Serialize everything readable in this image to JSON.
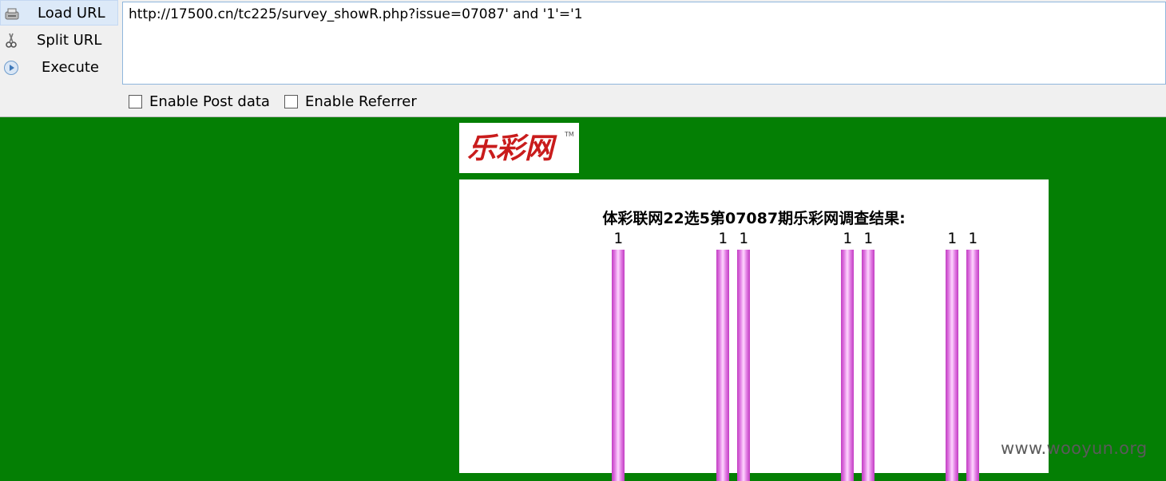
{
  "toolbar": {
    "load_url": "Load URL",
    "split_url": "Split URL",
    "execute": "Execute",
    "url_value": "http://17500.cn/tc225/survey_showR.php?issue=07087' and '1'='1",
    "enable_post": "Enable Post data",
    "enable_referrer": "Enable Referrer"
  },
  "page": {
    "background_color": "#047f04",
    "logo_text": "乐彩网",
    "logo_tm": "TM",
    "survey_title": "体彩联网22选5第07087期乐彩网调查结果:",
    "bar_color": "#d86ad9",
    "bars": [
      {
        "label": "1",
        "value": 1
      },
      {
        "label": "1",
        "value": 1
      },
      {
        "label": "1",
        "value": 1
      },
      {
        "label": "1",
        "value": 1
      },
      {
        "label": "1",
        "value": 1
      },
      {
        "label": "1",
        "value": 1
      },
      {
        "label": "1",
        "value": 1
      }
    ]
  },
  "watermark": "www.wooyun.org"
}
